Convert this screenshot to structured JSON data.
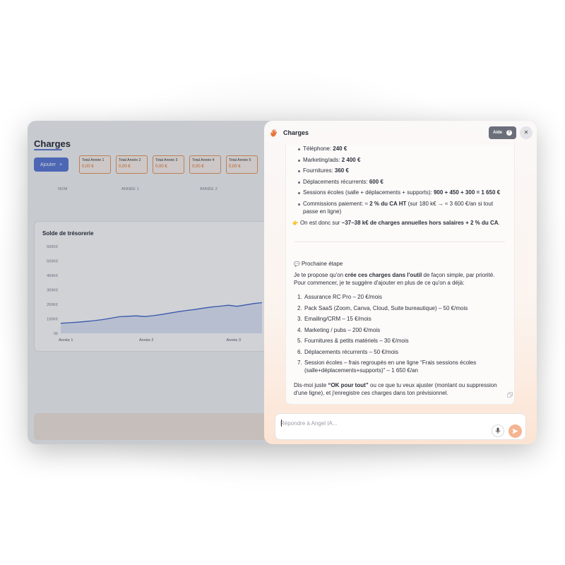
{
  "page": {
    "title": "Charges",
    "add_button": "Ajouter",
    "add_icon": "+",
    "totals": [
      {
        "label": "Total Année 1",
        "value": "0,00 €"
      },
      {
        "label": "Total Année 2",
        "value": "0,00 €"
      },
      {
        "label": "Total Année 3",
        "value": "0,00 €"
      },
      {
        "label": "Total Année 4",
        "value": "0,00 €"
      },
      {
        "label": "Total Année 5",
        "value": "0,00 €"
      }
    ],
    "table_headers": [
      "NOM",
      "ANNÉE 1",
      "ANNÉE 2"
    ]
  },
  "chart_data": {
    "type": "area",
    "title": "Solde de trésorerie",
    "yticks": [
      "600K€",
      "500K€",
      "400K€",
      "300K€",
      "200K€",
      "100K€",
      "0€"
    ],
    "xticks": [
      "Année 1",
      "Année 2",
      "Année 3"
    ],
    "ylim": [
      0,
      600000
    ],
    "x": [
      0,
      0.5,
      1,
      1.5,
      2,
      2.5,
      3,
      3.5,
      4,
      4.5,
      5,
      5.5,
      6,
      6.5,
      7,
      7.5,
      8,
      8.5,
      9,
      9.5,
      10,
      10.5,
      11,
      11.5,
      12
    ],
    "values": [
      70000,
      73000,
      77000,
      82000,
      88000,
      95000,
      105000,
      115000,
      118000,
      121000,
      116000,
      122000,
      130000,
      140000,
      150000,
      158000,
      165000,
      174000,
      182000,
      188000,
      194000,
      187000,
      196000,
      206000,
      212000
    ],
    "grid": false,
    "colors": {
      "line": "#3f63c9",
      "fill": "#dfe6f7"
    }
  },
  "panel": {
    "title": "Charges",
    "help_label": "Aide",
    "help_icon": "?",
    "close_icon": "✕",
    "message": {
      "lines_top": [
        {
          "pre": "Téléphone: ",
          "bold": "240 €",
          "post": ""
        },
        {
          "pre": "Marketing/ads: ",
          "bold": "2 400 €",
          "post": ""
        },
        {
          "pre": "Fournitures: ",
          "bold": "360 €",
          "post": ""
        },
        {
          "pre": "Déplacements récurrents: ",
          "bold": "600 €",
          "post": ""
        },
        {
          "pre": "Sessions écoles (salle + déplacements + supports): ",
          "bold": "900 + 450 + 300 = 1 650 €",
          "post": ""
        }
      ],
      "commission_pre": "Commissions paiement: ≈ ",
      "commission_bold": "2 % du CA HT",
      "commission_post": " (sur 180 k€ → ≈ 3 600 €/an si tout",
      "commission_line2": "passe en ligne)",
      "summary_icon": "👉",
      "summary_pre": "On est donc sur ",
      "summary_bold": "~37–38 k€ de charges annuelles hors salaires + 2 % du CA",
      "summary_post": ".",
      "next_icon": "💬",
      "next_title": "Prochaine étape",
      "intro_pre": "Je te propose qu'on ",
      "intro_bold": "crée ces charges dans l'outil",
      "intro_post": " de façon simple, par priorité.",
      "intro_line2": "Pour commencer, je te suggère d'ajouter en plus de ce qu'on a déjà:",
      "steps": [
        "Assurance RC Pro – 20 €/mois",
        "Pack SaaS (Zoom, Canva, Cloud, Suite bureautique) – 50 €/mois",
        "Emailing/CRM – 15 €/mois",
        "Marketing / pubs – 200 €/mois",
        "Fournitures & petits matériels – 30 €/mois",
        "Déplacements récurrents – 50 €/mois",
        "Session écoles – frais regroupés en une ligne “Frais sessions écoles"
      ],
      "step7_line2": "(salle+déplacements+supports)” – 1 650 €/an",
      "outro_pre": "Dis-moi juste ",
      "outro_bold": "“OK pour tout”",
      "outro_post": " ou ce que tu veux ajuster (montant ou suppression",
      "outro_line2": "d'une ligne), et j'enregistre ces charges dans ton prévisionnel."
    },
    "input_placeholder": "Répondre à Angel IA...",
    "colors": {
      "accent": "#e8743a",
      "send": "#f4b592"
    }
  }
}
